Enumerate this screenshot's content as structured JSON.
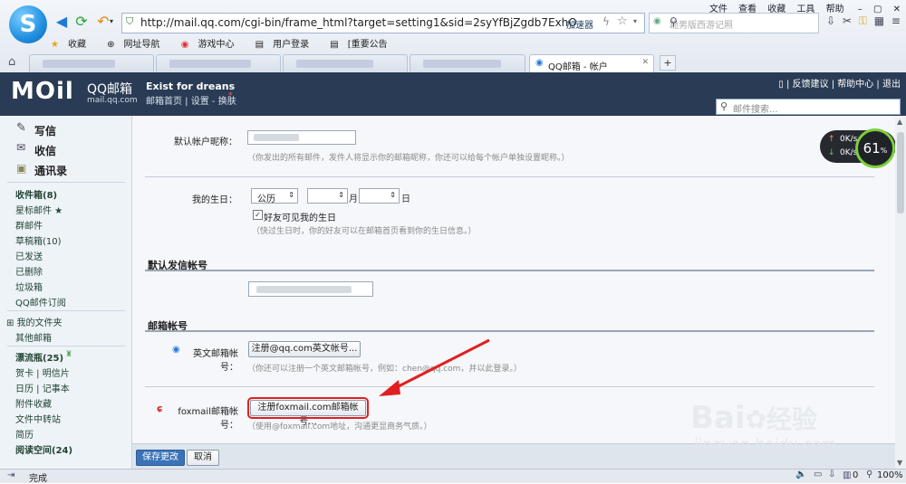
{
  "browser": {
    "logo_letter": "S",
    "url": "http://mail.qq.com/cgi-bin/frame_html?target=setting1&sid=2syYfBjZgdb7ExhO",
    "accelerator": "加速器",
    "search_placeholder": "跪男版西游记照",
    "menu": [
      "文件",
      "查看",
      "收藏",
      "工具",
      "帮助"
    ],
    "favorites": [
      "收藏",
      "网址导航",
      "游戏中心",
      "用户登录",
      "[重要公告"
    ],
    "active_tab": "QQ邮箱 - 帐户",
    "new_tab": "+"
  },
  "mail_header": {
    "brand": "MOil",
    "product": "QQ邮箱",
    "domain": "mail.qq.com",
    "motto": "Exist for dreans",
    "links": "邮箱首页 | 设置 - 换肤",
    "top_links": "| 反馈建议 | 帮助中心 | 退出",
    "search_placeholder": "邮件搜索..."
  },
  "sidebar": {
    "main": [
      {
        "label": "写信",
        "icon": "pencil-icon"
      },
      {
        "label": "收信",
        "icon": "inbox-icon"
      },
      {
        "label": "通讯录",
        "icon": "addressbook-icon"
      }
    ],
    "folders": [
      "收件箱(8)",
      "星标邮件 ★",
      "群邮件",
      "草稿箱(10)",
      "已发送",
      "已删除",
      "垃圾箱",
      "QQ邮件订阅"
    ],
    "my_folders": [
      "⊞ 我的文件夹",
      "其他邮箱"
    ],
    "apps": [
      "漂流瓶(25)",
      "贺卡 | 明信片",
      "日历 | 记事本",
      "附件收藏",
      "文件中转站",
      "简历",
      "阅读空间(24)"
    ]
  },
  "settings": {
    "nickname_label": "默认帐户昵称：",
    "nickname_hint": "（你发出的所有邮件，发件人将显示你的邮箱昵称，你还可以给每个帐户单独设置昵称。）",
    "birthday_label": "我的生日：",
    "calendar_type": "公历",
    "month_unit": "月",
    "day_unit": "日",
    "birthday_checkbox": "好友可见我的生日",
    "birthday_hint": "（快过生日时，你的好友可以在邮箱首页看到你的生日信息。）",
    "default_sender_title": "默认发信帐号",
    "mail_account_title": "邮箱帐号",
    "english_label": "英文邮箱帐号：",
    "english_button": "注册@qq.com英文帐号...",
    "english_hint": "（你还可以注册一个英文邮箱帐号，例如：chen@qq.com，并以此登录。）",
    "foxmail_label": "foxmail邮箱帐号：",
    "foxmail_button": "注册foxmail.com邮箱帐号...",
    "foxmail_hint": "（使用@foxmail.com地址，沟通更显商务气质。）"
  },
  "actions": {
    "save": "保存更改",
    "cancel": "取消"
  },
  "status_bar": {
    "text": "完成",
    "count": "0",
    "zoom": "100%"
  },
  "speed_widget": {
    "up": "0K/s",
    "down": "0K/s",
    "percent": "61",
    "unit": "%"
  },
  "watermark": {
    "brand": "Bai",
    "cn": "经验",
    "url": "jingyan.baidu.com"
  },
  "colors": {
    "header": "#2a3c55",
    "save_button": "#3b73b9",
    "annotation": "#e02020"
  }
}
